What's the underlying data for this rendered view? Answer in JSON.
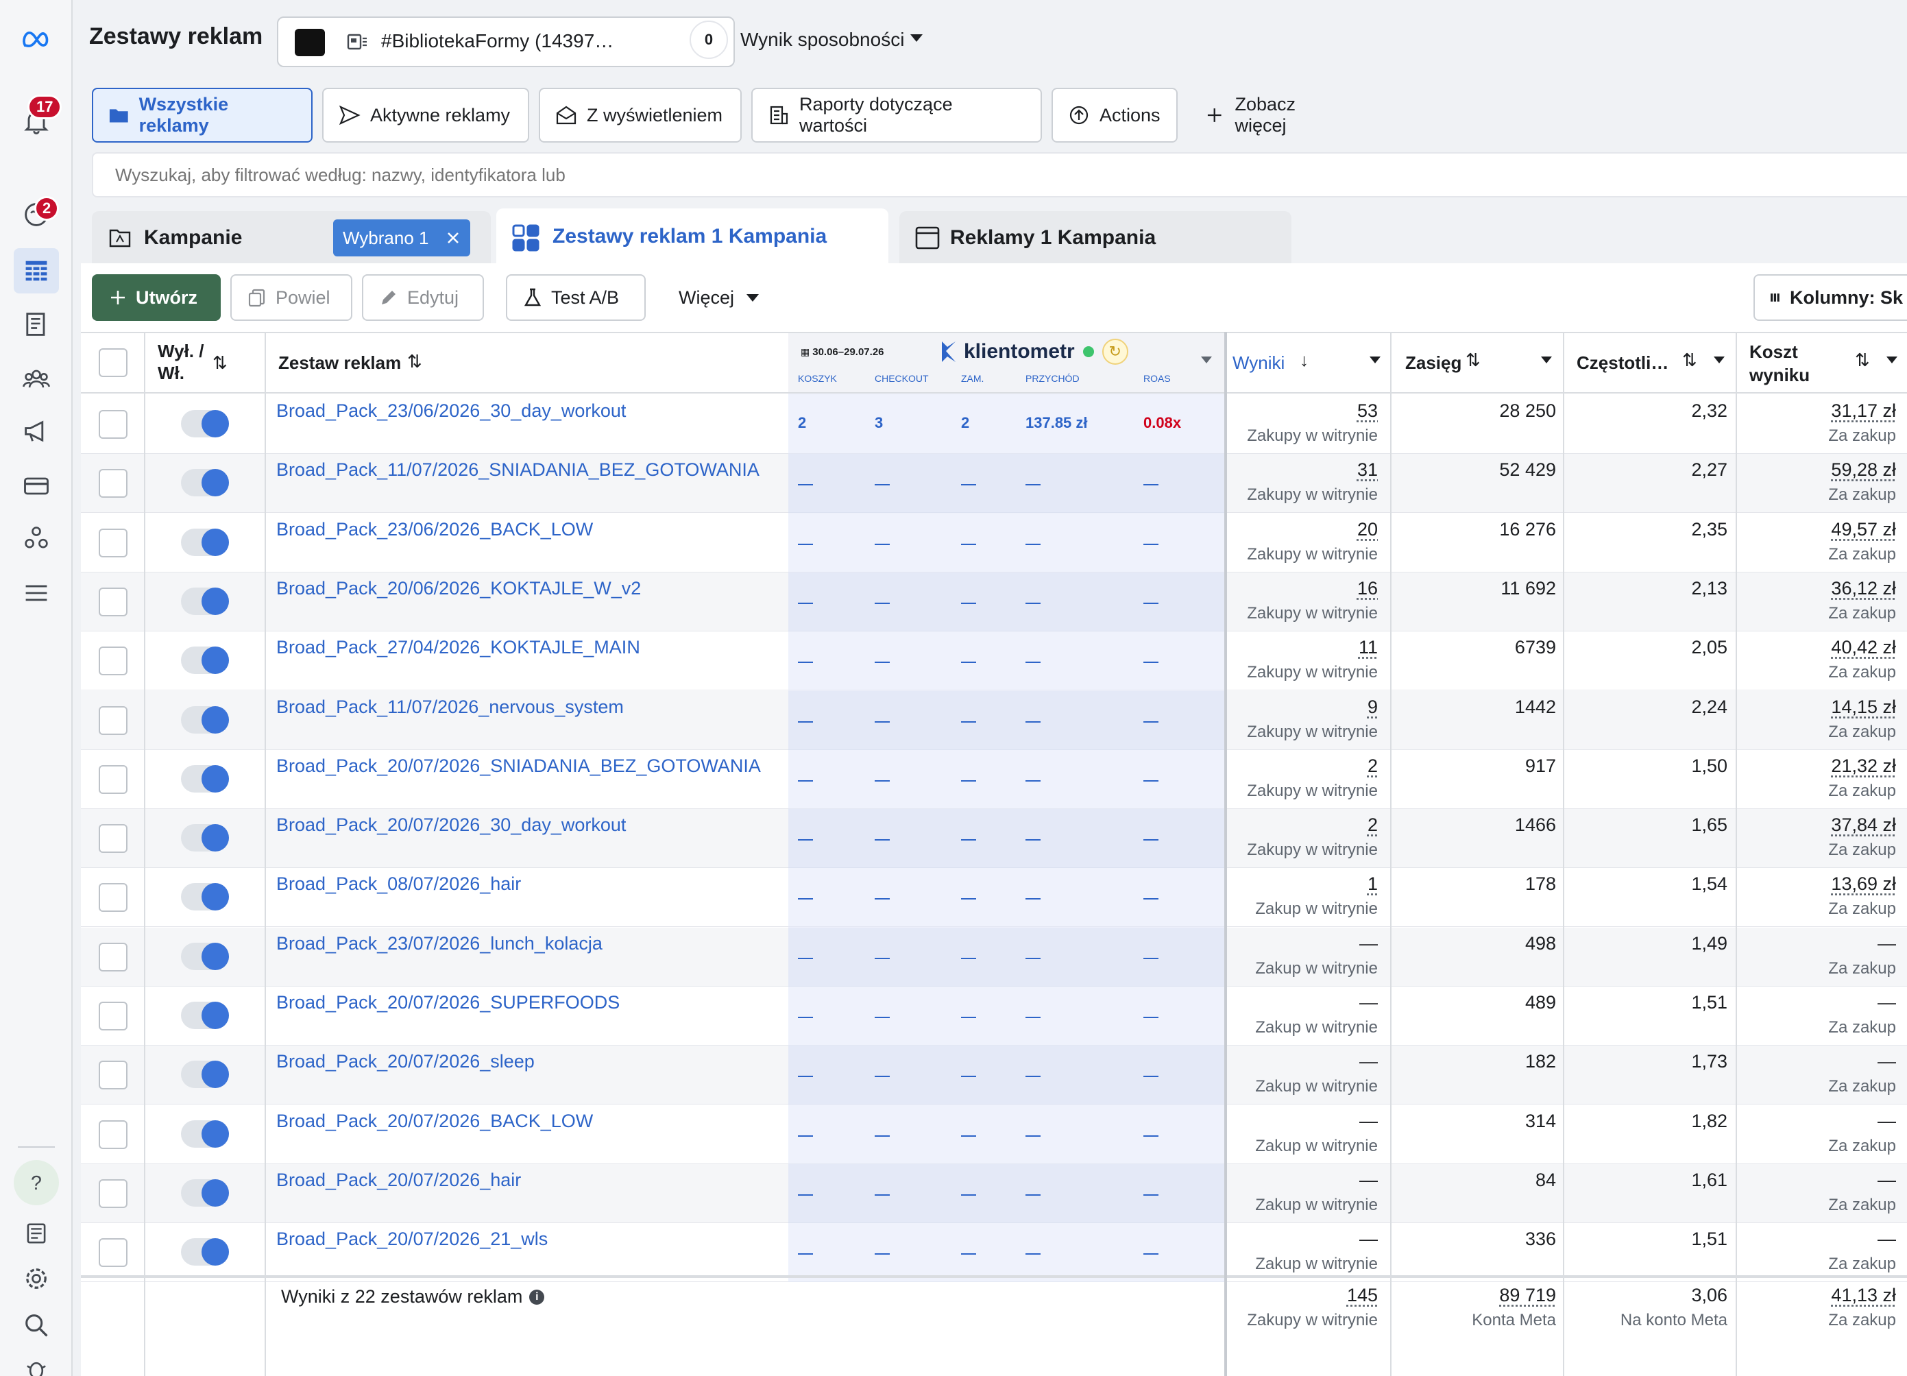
{
  "header": {
    "title": "Zestawy reklam",
    "account_name": "#BibliotekaFormy (14397…",
    "opportunity_score": "0",
    "opportunity_label": "Wynik sposobności"
  },
  "nav": {
    "notifications_badge": "17",
    "activity_badge": "2"
  },
  "quick_filters": [
    "Wszystkie reklamy",
    "Aktywne reklamy",
    "Z wyświetleniem",
    "Raporty dotyczące wartości",
    "Actions",
    "Zobacz więcej"
  ],
  "search": {
    "placeholder": "Wyszukaj, aby filtrować według: nazwy, identyfikatora lub"
  },
  "level_tabs": {
    "campaigns": "Kampanie",
    "selected_chip": "Wybrano 1",
    "adsets": "Zestawy reklam 1 Kampania",
    "ads": "Reklamy 1 Kampania"
  },
  "toolbar": {
    "create": "Utwórz",
    "duplicate": "Powiel",
    "edit": "Edytuj",
    "ab_test": "Test A/B",
    "more": "Więcej",
    "columns": "Kolumny: Sk"
  },
  "table": {
    "headers": {
      "toggle": "Wył. / Wł.",
      "name": "Zestaw reklam",
      "results": "Wyniki",
      "reach": "Zasięg",
      "frequency": "Częstotli…",
      "cost": "Koszt wyniku"
    },
    "klientometr": {
      "date_range": "30.06–29.07.26",
      "logo": "klientometr",
      "cols": [
        "KOSZYK",
        "CHECKOUT",
        "ZAM.",
        "PRZYCHÓD",
        "ROAS"
      ]
    },
    "rows": [
      {
        "name": "Broad_Pack_23/06/2026_30_day_workout",
        "kl": [
          "2",
          "3",
          "2",
          "137.85 zł",
          "0.08x"
        ],
        "results": "53",
        "results_sub": "Zakupy w witrynie",
        "reach": "28 250",
        "freq": "2,32",
        "cost": "31,17 zł",
        "cost_sub": "Za zakup"
      },
      {
        "name": "Broad_Pack_11/07/2026_SNIADANIA_BEZ_GOTOWANIA",
        "kl": null,
        "results": "31",
        "results_sub": "Zakupy w witrynie",
        "reach": "52 429",
        "freq": "2,27",
        "cost": "59,28 zł",
        "cost_sub": "Za zakup"
      },
      {
        "name": "Broad_Pack_23/06/2026_BACK_LOW",
        "kl": null,
        "results": "20",
        "results_sub": "Zakupy w witrynie",
        "reach": "16 276",
        "freq": "2,35",
        "cost": "49,57 zł",
        "cost_sub": "Za zakup"
      },
      {
        "name": "Broad_Pack_20/06/2026_KOKTAJLE_W_v2",
        "kl": null,
        "results": "16",
        "results_sub": "Zakupy w witrynie",
        "reach": "11 692",
        "freq": "2,13",
        "cost": "36,12 zł",
        "cost_sub": "Za zakup"
      },
      {
        "name": "Broad_Pack_27/04/2026_KOKTAJLE_MAIN",
        "kl": null,
        "results": "11",
        "results_sub": "Zakupy w witrynie",
        "reach": "6739",
        "freq": "2,05",
        "cost": "40,42 zł",
        "cost_sub": "Za zakup"
      },
      {
        "name": "Broad_Pack_11/07/2026_nervous_system",
        "kl": null,
        "results": "9",
        "results_sub": "Zakupy w witrynie",
        "reach": "1442",
        "freq": "2,24",
        "cost": "14,15 zł",
        "cost_sub": "Za zakup"
      },
      {
        "name": "Broad_Pack_20/07/2026_SNIADANIA_BEZ_GOTOWANIA",
        "kl": null,
        "results": "2",
        "results_sub": "Zakupy w witrynie",
        "reach": "917",
        "freq": "1,50",
        "cost": "21,32 zł",
        "cost_sub": "Za zakup"
      },
      {
        "name": "Broad_Pack_20/07/2026_30_day_workout",
        "kl": null,
        "results": "2",
        "results_sub": "Zakupy w witrynie",
        "reach": "1466",
        "freq": "1,65",
        "cost": "37,84 zł",
        "cost_sub": "Za zakup"
      },
      {
        "name": "Broad_Pack_08/07/2026_hair",
        "kl": null,
        "results": "1",
        "results_sub": "Zakup w witrynie",
        "reach": "178",
        "freq": "1,54",
        "cost": "13,69 zł",
        "cost_sub": "Za zakup"
      },
      {
        "name": "Broad_Pack_23/07/2026_lunch_kolacja",
        "kl": null,
        "results": "—",
        "results_sub": "Zakup w witrynie",
        "reach": "498",
        "freq": "1,49",
        "cost": "—",
        "cost_sub": "Za zakup"
      },
      {
        "name": "Broad_Pack_20/07/2026_SUPERFOODS",
        "kl": null,
        "results": "—",
        "results_sub": "Zakup w witrynie",
        "reach": "489",
        "freq": "1,51",
        "cost": "—",
        "cost_sub": "Za zakup"
      },
      {
        "name": "Broad_Pack_20/07/2026_sleep",
        "kl": null,
        "results": "—",
        "results_sub": "Zakup w witrynie",
        "reach": "182",
        "freq": "1,73",
        "cost": "—",
        "cost_sub": "Za zakup"
      },
      {
        "name": "Broad_Pack_20/07/2026_BACK_LOW",
        "kl": null,
        "results": "—",
        "results_sub": "Zakup w witrynie",
        "reach": "314",
        "freq": "1,82",
        "cost": "—",
        "cost_sub": "Za zakup"
      },
      {
        "name": "Broad_Pack_20/07/2026_hair",
        "kl": null,
        "results": "—",
        "results_sub": "Zakup w witrynie",
        "reach": "84",
        "freq": "1,61",
        "cost": "—",
        "cost_sub": "Za zakup"
      },
      {
        "name": "Broad_Pack_20/07/2026_21_wls",
        "kl": null,
        "results": "—",
        "results_sub": "Zakup w witrynie",
        "reach": "336",
        "freq": "1,51",
        "cost": "—",
        "cost_sub": "Za zakup"
      }
    ],
    "summary": {
      "label": "Wyniki z 22 zestawów reklam",
      "results": "145",
      "results_sub": "Zakupy w witrynie",
      "reach": "89 719",
      "reach_sub": "Konta Meta",
      "freq": "3,06",
      "freq_sub": "Na konto Meta",
      "cost": "41,13 zł",
      "cost_sub": "Za zakup"
    }
  },
  "colors": {
    "accent": "#2d64c8",
    "create_green": "#3d6b4f",
    "roas_red": "#d0021b",
    "badge_red": "#c8102e"
  }
}
